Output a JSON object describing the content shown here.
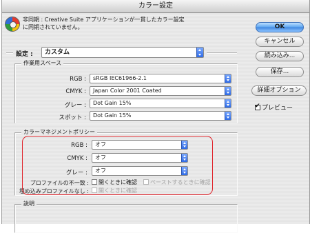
{
  "window": {
    "title": "カラー設定"
  },
  "sync": {
    "line1": "非同期 : Creative Suite アプリケーションが一貫したカラー設定",
    "line2": "に同期されていません。"
  },
  "settings": {
    "label": "設定 :",
    "value": "カスタム"
  },
  "workspace": {
    "title": "作業用スペース",
    "rows": [
      {
        "label": "RGB :",
        "value": "sRGB IEC61966-2.1"
      },
      {
        "label": "CMYK :",
        "value": "Japan Color 2001 Coated"
      },
      {
        "label": "グレー :",
        "value": "Dot Gain 15%"
      },
      {
        "label": "スポット :",
        "value": "Dot Gain 15%"
      }
    ]
  },
  "policy": {
    "title": "カラーマネジメントポリシー",
    "rows": [
      {
        "label": "RGB :",
        "value": "オフ"
      },
      {
        "label": "CMYK :",
        "value": "オフ"
      },
      {
        "label": "グレー :",
        "value": "オフ"
      }
    ],
    "mismatch": {
      "label": "プロファイルの不一致 :",
      "opt1": "開くときに確認",
      "opt2": "ペーストするときに確認"
    },
    "missing": {
      "label": "埋め込みプロファイルなし :",
      "opt1": "開くときに確認"
    }
  },
  "description": {
    "title": "説明"
  },
  "buttons": {
    "ok": "OK",
    "cancel": "キャンセル",
    "load": "読み込み...",
    "save": "保存...",
    "advanced": "詳細オプション"
  },
  "preview": {
    "label": "プレビュー",
    "checked": true
  },
  "icons": {
    "sync": "color-sync-wheel-icon",
    "popup_arrow": "updown-arrow-icon"
  },
  "colors": {
    "highlight": "#e0242b",
    "accent": "#2f6be6"
  }
}
